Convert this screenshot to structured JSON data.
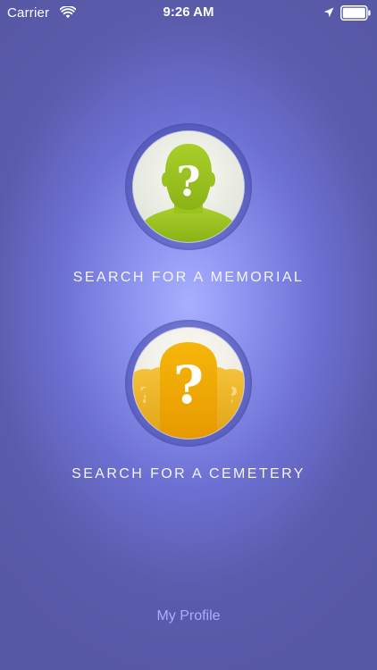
{
  "status_bar": {
    "carrier": "Carrier",
    "time": "9:26 AM",
    "icons": [
      "wifi-icon",
      "location-arrow-icon",
      "battery-icon"
    ]
  },
  "memorial": {
    "label": "SEARCH FOR A MEMORIAL",
    "icon": "person-silhouette-question-icon",
    "icon_color": "#9bc21f"
  },
  "cemetery": {
    "label": "SEARCH FOR A CEMETERY",
    "icon": "headstones-question-icon",
    "icon_color": "#f0a800"
  },
  "footer": {
    "my_profile": "My Profile"
  },
  "colors": {
    "background_center": "#a7afff",
    "background_edge": "#5758a6",
    "link": "#a9afff",
    "text": "#ffffff"
  }
}
